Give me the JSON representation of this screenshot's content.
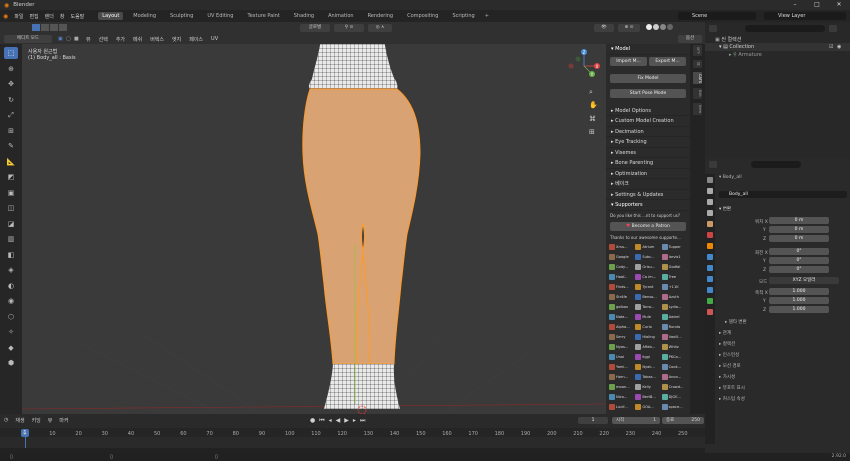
{
  "app": {
    "title": "Blender",
    "version": "2.92.0"
  },
  "window_controls": [
    "–",
    "□",
    "✕"
  ],
  "menu": [
    "파일",
    "편집",
    "렌더",
    "창",
    "도움말"
  ],
  "workspaces": [
    "Layout",
    "Modeling",
    "Sculpting",
    "UV Editing",
    "Texture Paint",
    "Shading",
    "Animation",
    "Rendering",
    "Compositing",
    "Scripting"
  ],
  "active_workspace": "Layout",
  "add_workspace": "+",
  "scene": "Scene",
  "view_layer": "View Layer",
  "viewport_header": {
    "mode": "에디트 모드",
    "items": [
      "뷰",
      "선택",
      "추가",
      "메쉬",
      "버텍스",
      "엣지",
      "페이스",
      "UV"
    ],
    "transform": "글로벌",
    "options": "옵션"
  },
  "viewport": {
    "view_name": "사용자 원근법",
    "object_name": "(1) Body_all : Basis",
    "gizmo": {
      "x": "X",
      "y": "Y",
      "z": "Z"
    },
    "wire_color": "#e58a1f",
    "body_color": "#d9a273"
  },
  "npanel": {
    "model_header": "Model",
    "buttons": {
      "import": "Import M...",
      "export": "Export M...",
      "fix": "Fix Model",
      "pose": "Start Pose Mode"
    },
    "sections": [
      "Model Options",
      "Custom Model Creation",
      "Decimation",
      "Eye Tracking",
      "Visemes",
      "Bone Parenting",
      "Optimization",
      "베이크",
      "Settings & Updates",
      "Supporters"
    ],
    "support_text": "Do you like this ...nt to support us?",
    "patron_button": "Become a Patron",
    "thanks": "Thanks to our awesome supporte...",
    "supporters": [
      "Xrsu...",
      "Atrium",
      "Tupper",
      "Google",
      "Subc...",
      "Iarvis1",
      "Cody...",
      "Grisu...",
      "Godfal",
      "Hoaf...",
      "Ca im...",
      "Tree",
      "Finds...",
      "Tyrant",
      "+11K",
      "Str4fe",
      "Benso...",
      "Azuth",
      "golbox",
      "Torro...",
      "Lydia...",
      "Nata...",
      "Mule",
      "Awirel",
      "Alpha...",
      "Curio",
      "Runda",
      "Serry",
      "Hialing",
      "Vanill...",
      "Nyas...",
      "Affab...",
      "Whitz",
      "Unai",
      "Iiggi",
      "PKCa...",
      "Yami...",
      "Nyak...",
      "Cook...",
      "Horn...",
      "Tabas...",
      "Anon...",
      "moon...",
      "Kelly",
      "Crowd...",
      "Nico...",
      "BertB...",
      "DjGE...",
      "Lucif...",
      "GOA...",
      "space..."
    ],
    "supporter_colors": [
      "#b04a3a",
      "#c08a2a",
      "#6a8ab0",
      "#8a6a4a",
      "#3a6ab0",
      "#b06a8a",
      "#6aa04a",
      "#a0a0a0",
      "#b0904a",
      "#4a8ab0",
      "#9a4ab0",
      "#5ab0a0"
    ]
  },
  "vtabs": [
    "도구",
    "뷰",
    "CATS",
    "Edit",
    "Item"
  ],
  "outliner": {
    "search_placeholder": "",
    "scene_collection": "씬 컬렉션",
    "collection": "Collection",
    "armature": "Armature"
  },
  "properties": {
    "object_name": "Body_all",
    "object_field": "Body_all",
    "transform_header": "변환",
    "location_label": "위치 X",
    "location": [
      "0 m",
      "0 m",
      "0 m"
    ],
    "rotation_label": "회전 X",
    "rotation": [
      "0°",
      "0°",
      "0°"
    ],
    "rotation_mode_label": "모드",
    "rotation_mode": "XYZ 오일러",
    "scale_label": "축척 X",
    "scale": [
      "1.000",
      "1.000",
      "1.000"
    ],
    "axis_y": "Y",
    "axis_z": "Z",
    "delta_transform": "델타 변환",
    "sections": [
      "관계",
      "컬렉션",
      "인스턴싱",
      "모션 경로",
      "가시성",
      "뷰포트 표시",
      "커스텀 속성"
    ]
  },
  "timeline": {
    "menus": [
      "재생",
      "키잉",
      "뷰",
      "마커"
    ],
    "current_frame": "1",
    "start_label": "시작",
    "start": "1",
    "end_label": "종료",
    "end": "250",
    "ticks": [
      "0",
      "10",
      "20",
      "30",
      "40",
      "50",
      "60",
      "70",
      "80",
      "90",
      "100",
      "110",
      "120",
      "130",
      "140",
      "150",
      "160",
      "170",
      "180",
      "190",
      "200",
      "210",
      "220",
      "230",
      "240",
      "250"
    ],
    "cursor": "1"
  }
}
